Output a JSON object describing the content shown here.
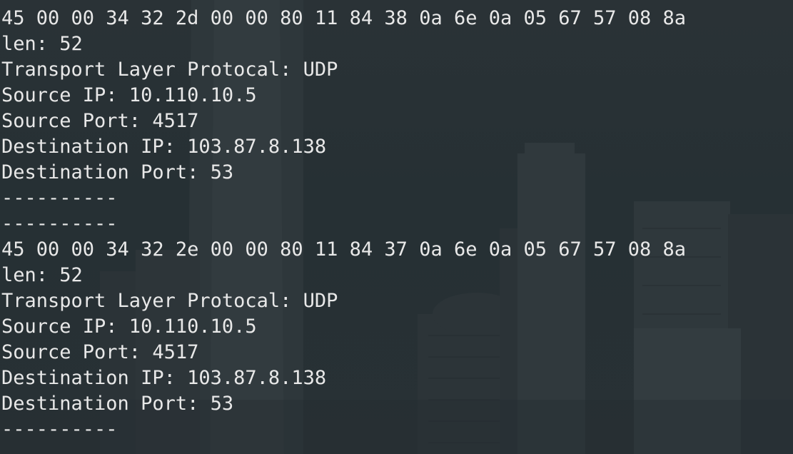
{
  "terminal": {
    "lines": [
      "----------",
      "45 00 00 34 32 2d 00 00 80 11 84 38 0a 6e 0a 05 67 57 08 8a",
      "len: 52",
      "Transport Layer Protocal: UDP",
      "Source IP: 10.110.10.5",
      "Source Port: 4517",
      "Destination IP: 103.87.8.138",
      "Destination Port: 53",
      "----------",
      "----------",
      "45 00 00 34 32 2e 00 00 80 11 84 37 0a 6e 0a 05 67 57 08 8a",
      "len: 52",
      "Transport Layer Protocal: UDP",
      "Source IP: 10.110.10.5",
      "Source Port: 4517",
      "Destination IP: 103.87.8.138",
      "Destination Port: 53",
      "----------"
    ]
  },
  "colors": {
    "text": "#e8e8e8",
    "background": "#262e32"
  }
}
